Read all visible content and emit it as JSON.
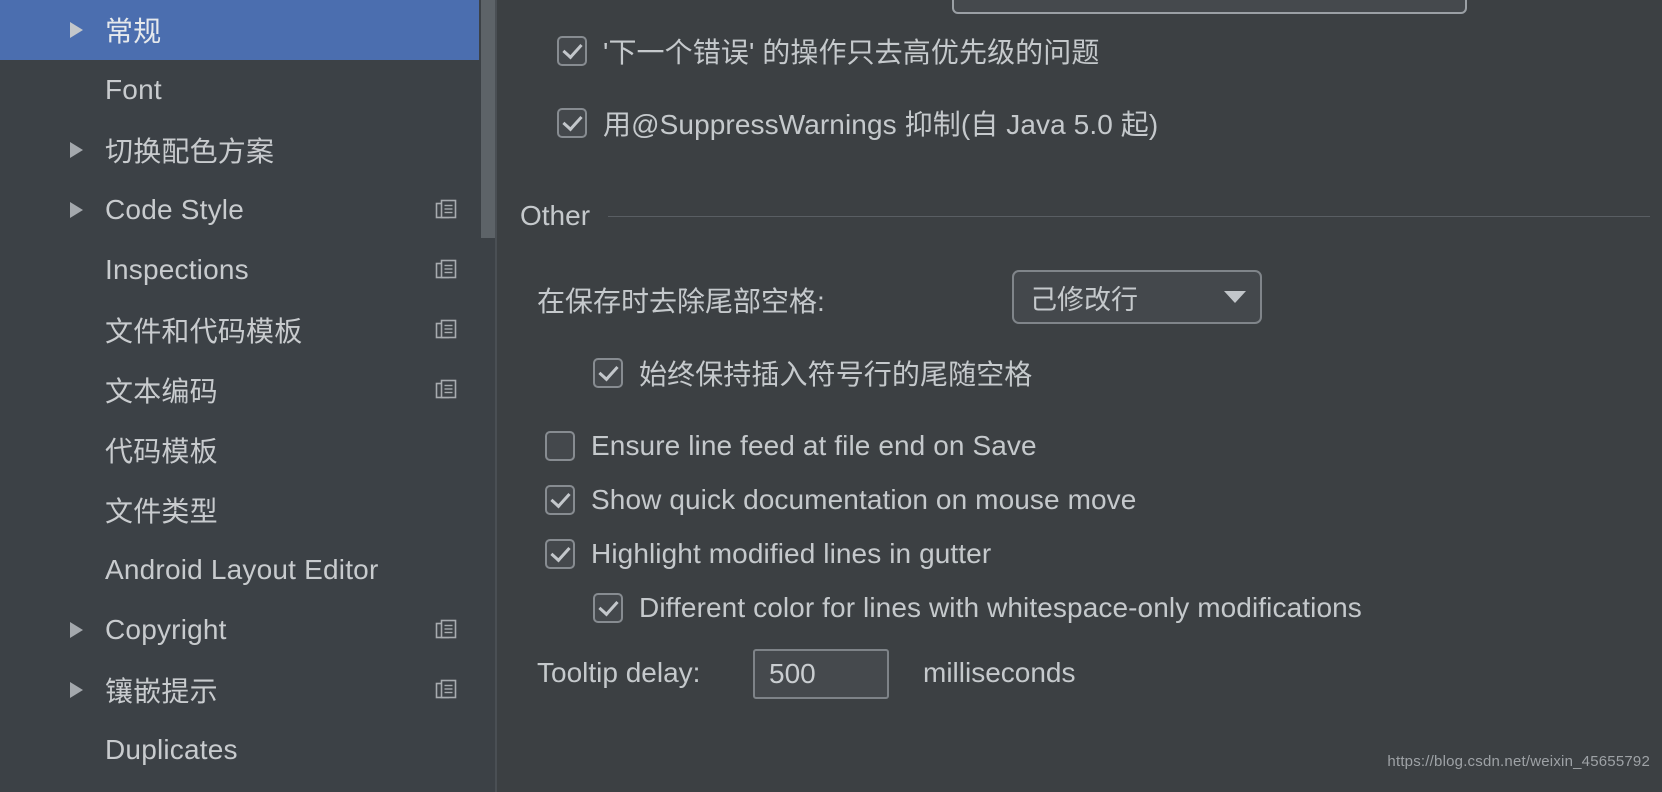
{
  "sidebar": {
    "items": [
      {
        "label": "常规",
        "expandable": true,
        "selected": true,
        "copy": false
      },
      {
        "label": "Font",
        "expandable": false,
        "selected": false,
        "copy": false
      },
      {
        "label": "切换配色方案",
        "expandable": true,
        "selected": false,
        "copy": false
      },
      {
        "label": "Code Style",
        "expandable": true,
        "selected": false,
        "copy": true
      },
      {
        "label": "Inspections",
        "expandable": false,
        "selected": false,
        "copy": true
      },
      {
        "label": "文件和代码模板",
        "expandable": false,
        "selected": false,
        "copy": true
      },
      {
        "label": "文本编码",
        "expandable": false,
        "selected": false,
        "copy": true
      },
      {
        "label": "代码模板",
        "expandable": false,
        "selected": false,
        "copy": false
      },
      {
        "label": "文件类型",
        "expandable": false,
        "selected": false,
        "copy": false
      },
      {
        "label": "Android Layout Editor",
        "expandable": false,
        "selected": false,
        "copy": false
      },
      {
        "label": "Copyright",
        "expandable": true,
        "selected": false,
        "copy": true
      },
      {
        "label": "镶嵌提示",
        "expandable": true,
        "selected": false,
        "copy": true
      },
      {
        "label": "Duplicates",
        "expandable": false,
        "selected": false,
        "copy": false
      }
    ],
    "icons": {
      "expand": "triangle-right-icon",
      "copy": "copy-icon",
      "scrollbar": "vertical-scrollbar"
    }
  },
  "main": {
    "top_checkboxes": [
      {
        "label": "'下一个错误' 的操作只去高优先级的问题",
        "checked": true
      },
      {
        "label": "用@SuppressWarnings 抑制(自 Java 5.0 起)",
        "checked": true
      }
    ],
    "section_other": {
      "title": "Other"
    },
    "strip_trailing": {
      "label": "在保存时去除尾部空格:",
      "value": "己修改行",
      "caret_icon": "chevron-down-icon"
    },
    "keep_caret_line": {
      "label": "始终保持插入符号行的尾随空格",
      "checked": true
    },
    "other_checkboxes": [
      {
        "label": "Ensure line feed at file end on Save",
        "checked": false
      },
      {
        "label": "Show quick documentation on mouse move",
        "checked": true
      },
      {
        "label": "Highlight modified lines in gutter",
        "checked": true
      }
    ],
    "whitespace_color": {
      "label": "Different color for lines with whitespace-only modifications",
      "checked": true
    },
    "tooltip_delay": {
      "label": "Tooltip delay:",
      "value": "500",
      "unit": "milliseconds"
    }
  },
  "watermark": "https://blog.csdn.net/weixin_45655792",
  "colors": {
    "background": "#3c4043",
    "sidebar_background": "#3c4146",
    "selection": "#4b6eaf",
    "text": "#c5c9cc",
    "border": "#80858a",
    "scrollbar_thumb": "#5d6368"
  }
}
